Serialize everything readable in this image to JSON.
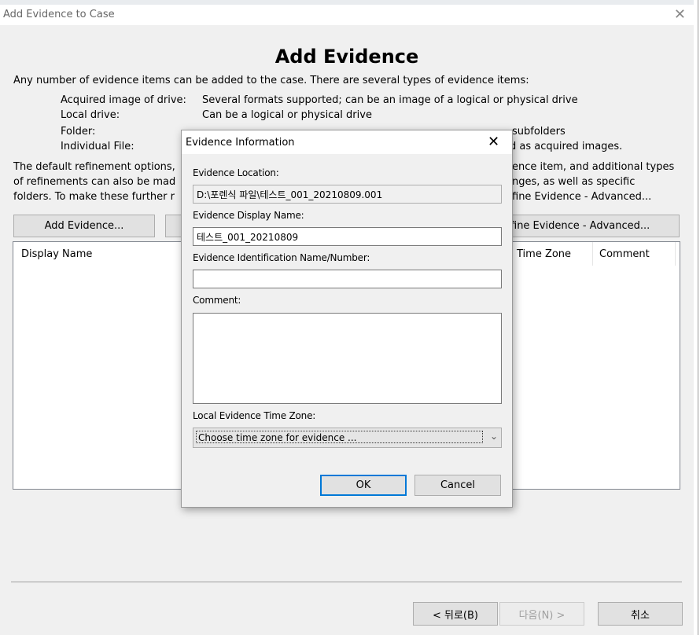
{
  "window": {
    "title": "Add Evidence to Case",
    "heading": "Add Evidence"
  },
  "intro": {
    "line": "Any number of evidence items can be added to the case. There are several types of evidence items:",
    "types": [
      {
        "label": "Acquired image of drive:",
        "desc": "Several formats supported; can be an image of a logical or physical drive"
      },
      {
        "label": "Local drive:",
        "desc": "Can be a logical or physical drive"
      },
      {
        "label": "Folder:",
        "desc": "subfolders"
      },
      {
        "label": "Individual File:",
        "desc": "d as acquired images."
      }
    ],
    "refine_left": [
      "The default refinement options,",
      "of refinements can also be mad",
      "folders. To make these further r"
    ],
    "refine_right": [
      "ence item, and additional types",
      "nges, as well as specific",
      "fine Evidence - Advanced..."
    ]
  },
  "buttons": {
    "add_evidence": "Add Evidence...",
    "refine_advanced": "fine Evidence - Advanced...",
    "back": "< 뒤로(B)",
    "next": "다음(N) >",
    "cancel": "취소"
  },
  "table": {
    "columns": [
      "Display Name",
      "Time Zone",
      "Comment"
    ]
  },
  "dialog": {
    "title": "Evidence Information",
    "location_label": "Evidence Location:",
    "location_value": "D:\\포렌식 파일\\테스트_001_20210809.001",
    "display_name_label": "Evidence Display Name:",
    "display_name_value": "테스트_001_20210809",
    "id_label": "Evidence Identification Name/Number:",
    "id_value": "",
    "comment_label": "Comment:",
    "timezone_label": "Local Evidence Time Zone:",
    "timezone_value": "Choose time zone for evidence ...",
    "ok": "OK",
    "cancel": "Cancel"
  }
}
